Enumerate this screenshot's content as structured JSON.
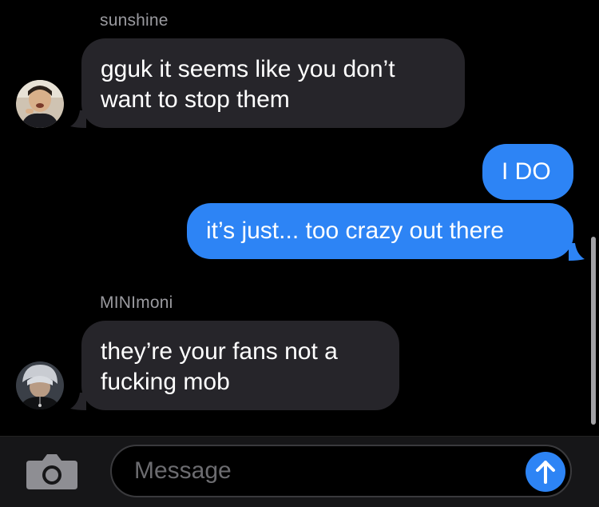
{
  "colors": {
    "incoming_bubble": "#26252a",
    "outgoing_bubble": "#2d84f5",
    "sender_name": "#9a9a9f",
    "background": "#000000"
  },
  "thread": {
    "messages": [
      {
        "direction": "incoming",
        "sender": "sunshine",
        "text": "gguk it seems like you don’t\nwant to stop them"
      },
      {
        "direction": "outgoing",
        "text": "I DO"
      },
      {
        "direction": "outgoing",
        "text": "it’s just... too crazy out there"
      },
      {
        "direction": "incoming",
        "sender": "MINImoni",
        "text": "they’re your fans not a\nfucking mob"
      }
    ]
  },
  "input": {
    "placeholder": "Message",
    "camera_icon": "camera-icon",
    "send_icon": "arrow-up-icon"
  }
}
